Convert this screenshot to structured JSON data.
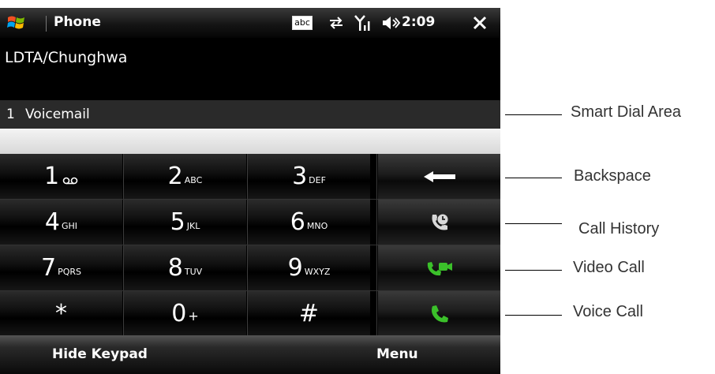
{
  "titlebar": {
    "app_title": "Phone",
    "input_mode": "abc",
    "time": "2:09"
  },
  "operator": "LDTA/Chunghwa",
  "smart_dial": {
    "number": "1",
    "name": "Voicemail"
  },
  "keypad": {
    "row1": [
      {
        "digit": "1",
        "letters": ""
      },
      {
        "digit": "2",
        "letters": "ABC"
      },
      {
        "digit": "3",
        "letters": "DEF"
      }
    ],
    "row2": [
      {
        "digit": "4",
        "letters": "GHI"
      },
      {
        "digit": "5",
        "letters": "JKL"
      },
      {
        "digit": "6",
        "letters": "MNO"
      }
    ],
    "row3": [
      {
        "digit": "7",
        "letters": "PQRS"
      },
      {
        "digit": "8",
        "letters": "TUV"
      },
      {
        "digit": "9",
        "letters": "WXYZ"
      }
    ],
    "row4": [
      {
        "digit": "*",
        "letters": ""
      },
      {
        "digit": "0",
        "letters": "+"
      },
      {
        "digit": "#",
        "letters": ""
      }
    ]
  },
  "function_keys": [
    "backspace-icon",
    "call-history-icon",
    "video-call-icon",
    "voice-call-icon"
  ],
  "softkeys": {
    "left": "Hide Keypad",
    "right": "Menu"
  },
  "annotations": {
    "smart_dial": "Smart Dial Area",
    "backspace": "Backspace",
    "call_history": "Call History",
    "video_call": "Video Call",
    "voice_call": "Voice Call"
  },
  "colors": {
    "call_green": "#3bc02a"
  }
}
